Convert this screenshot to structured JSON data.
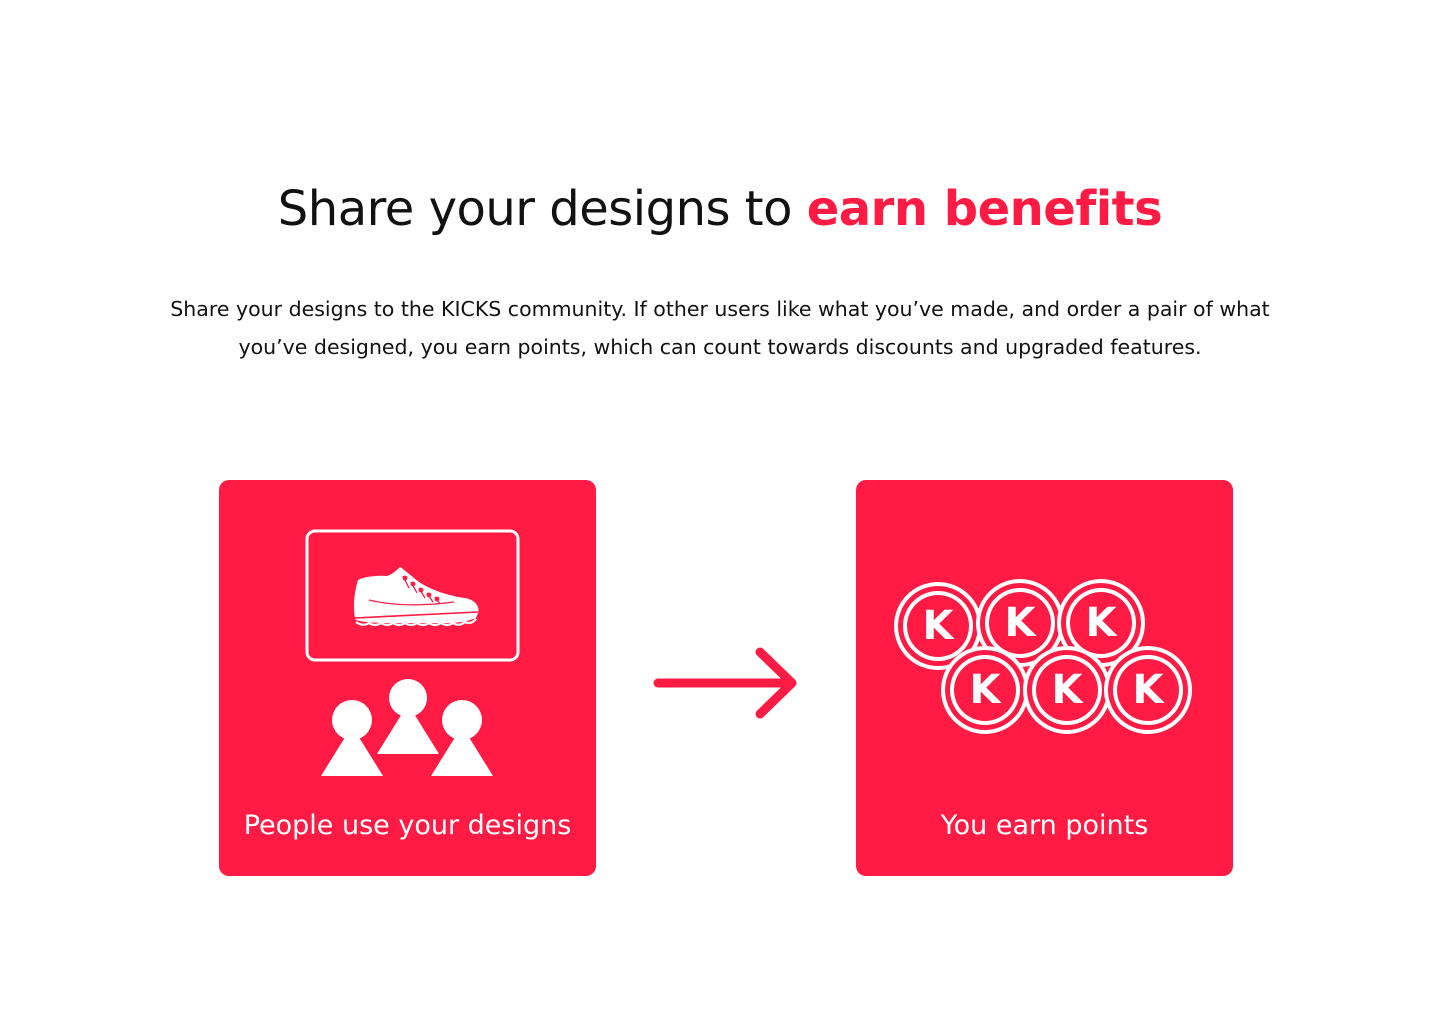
{
  "hero": {
    "headline_plain": "Share your designs to ",
    "headline_accent": "earn benefits",
    "description": "Share your designs to the KICKS community. If other users like what you’ve made, and order a pair of what you’ve designed, you earn points, which can count towards discounts and upgraded features."
  },
  "steps": [
    {
      "label": "People use your designs",
      "icons": [
        "shoe-icon",
        "people-icon"
      ]
    },
    {
      "label": "You earn points",
      "icons": [
        "kicks-coin-icon"
      ],
      "coin_letter": "K"
    }
  ],
  "colors": {
    "accent": "#ff1b44",
    "text": "#111111",
    "background": "#ffffff",
    "on_accent": "#ffffff"
  }
}
